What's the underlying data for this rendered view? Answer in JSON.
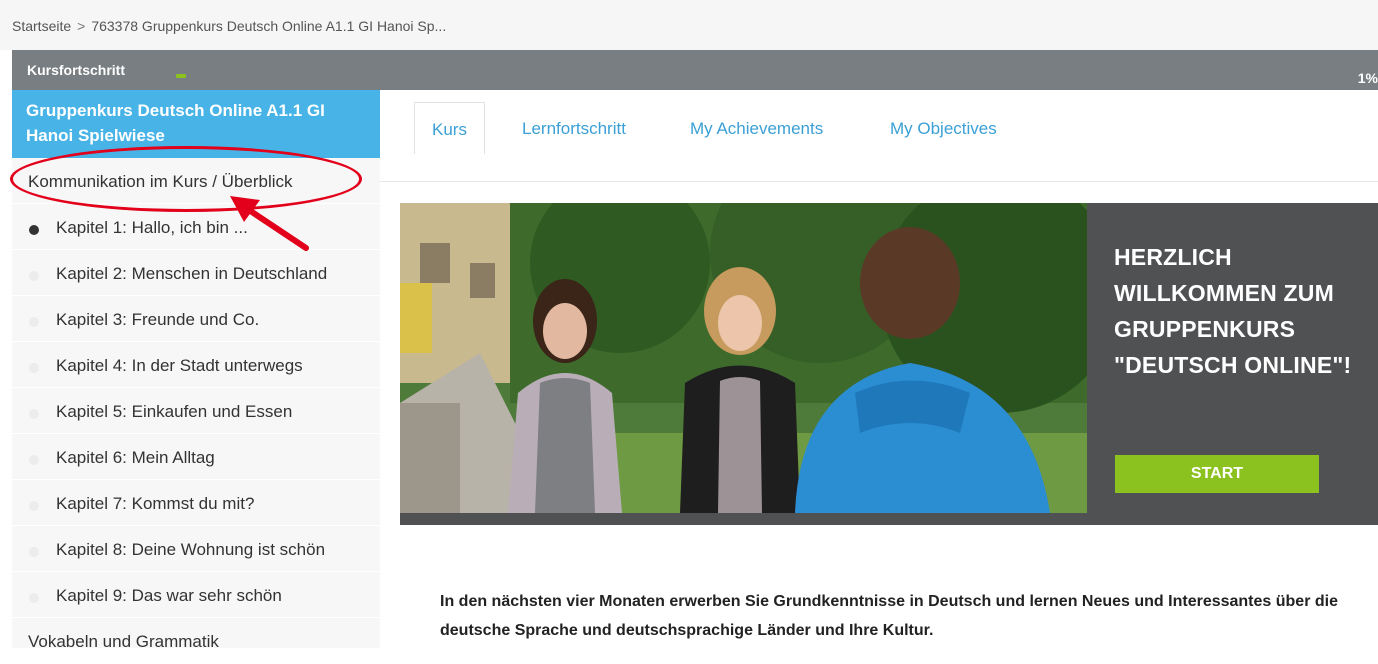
{
  "breadcrumb": {
    "home": "Startseite",
    "separator": ">",
    "current": "763378 Gruppenkurs Deutsch Online A1.1 GI Hanoi Sp..."
  },
  "progress": {
    "label": "Kursfortschritt",
    "percent_text": "1%",
    "value": 1,
    "accent": "#8cc21f"
  },
  "sidebar": {
    "course_title": "Gruppenkurs Deutsch Online A1.1 GI Hanoi Spielwiese",
    "items": [
      {
        "label": "Kommunikation im Kurs / Überblick"
      },
      {
        "label": "Kapitel 1: Hallo, ich bin ..."
      },
      {
        "label": "Kapitel 2: Menschen in Deutschland"
      },
      {
        "label": "Kapitel 3: Freunde und Co."
      },
      {
        "label": "Kapitel 4: In der Stadt unterwegs"
      },
      {
        "label": "Kapitel 5: Einkaufen und Essen"
      },
      {
        "label": "Kapitel 6: Mein Alltag"
      },
      {
        "label": "Kapitel 7: Kommst du mit?"
      },
      {
        "label": "Kapitel 8: Deine Wohnung ist schön"
      },
      {
        "label": "Kapitel 9: Das war sehr schön"
      },
      {
        "label": "Vokabeln und Grammatik"
      }
    ]
  },
  "tabs": [
    {
      "label": "Kurs"
    },
    {
      "label": "Lernfortschritt"
    },
    {
      "label": "My Achievements"
    },
    {
      "label": "My Objectives"
    }
  ],
  "hero": {
    "line1": "HERZLICH",
    "line2": "WILLKOMMEN ZUM",
    "line3": "GRUPPENKURS",
    "line4": "\"DEUTSCH ONLINE\"!",
    "start_label": "START",
    "button_color": "#8cc21f"
  },
  "intro": {
    "text": "In den nächsten vier Monaten erwerben Sie Grundkenntnisse in Deutsch und lernen Neues und Interessantes über die deutsche Sprache und deutschsprachige Länder und Ihre Kultur."
  },
  "colors": {
    "accent_blue": "#48b3e6",
    "tab_text": "#3aa0d6",
    "annotation_red": "#e2001a"
  }
}
